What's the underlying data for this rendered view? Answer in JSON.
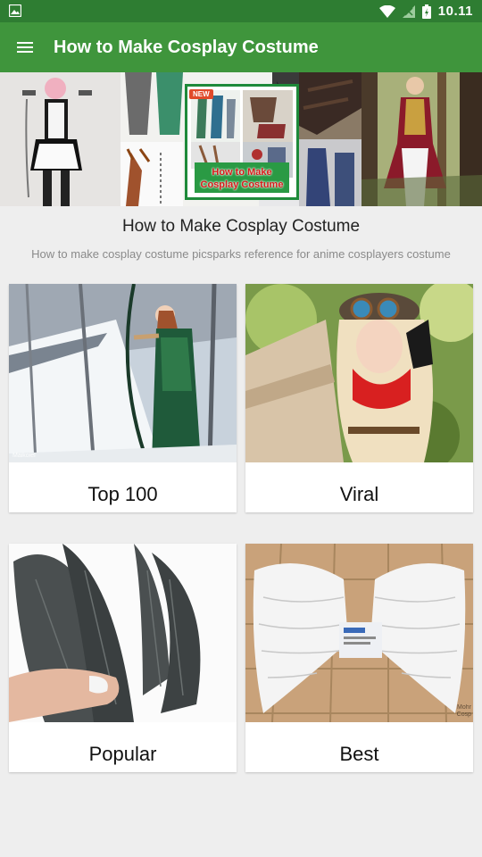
{
  "status_bar": {
    "time": "10.11",
    "icons": [
      "notification-image-icon",
      "wifi-icon",
      "signal-icon",
      "battery-icon"
    ]
  },
  "app_bar": {
    "title": "How to Make Cosplay Costume",
    "menu_icon": "hamburger-menu-icon"
  },
  "banner": {
    "badge": "NEW",
    "caption_line1": "How to Make",
    "caption_line2": "Cosplay Costume"
  },
  "header": {
    "title": "How to Make Cosplay Costume",
    "subtitle": "How to make cosplay costume picsparks reference for anime cosplayers costume"
  },
  "categories": [
    {
      "label": "Top 100",
      "watermark": "Maikoiel"
    },
    {
      "label": "Viral"
    },
    {
      "label": "Popular"
    },
    {
      "label": "Best",
      "watermark": "Mohr Cosp"
    }
  ],
  "colors": {
    "status_bar": "#2e7d32",
    "app_bar": "#3f953c",
    "background": "#eeeeee"
  }
}
